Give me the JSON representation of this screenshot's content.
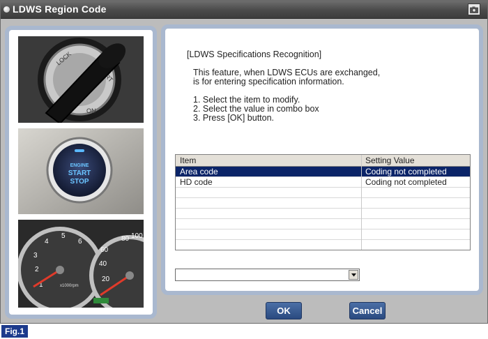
{
  "window": {
    "title": "LDWS Region Code",
    "icons": {
      "title_bullet": "window-bullet-icon",
      "title_button": "camera-icon"
    }
  },
  "images": {
    "ignition_key": "ignition-key-photo",
    "start_stop_button": "engine-start-stop-button-photo",
    "gauge_cluster": "instrument-cluster-photo"
  },
  "instructions": {
    "heading": "[LDWS Specifications Recognition]",
    "description": [
      "This feature, when LDWS ECUs are exchanged,",
      "is for entering specification information."
    ],
    "steps": [
      "1. Select the item to modify.",
      "2. Select the value in combo box",
      "3. Press [OK] button."
    ]
  },
  "table": {
    "columns": [
      "Item",
      "Setting Value"
    ],
    "rows": [
      {
        "item": "Area code",
        "value": "Coding not completed",
        "selected": true
      },
      {
        "item": "HD code",
        "value": "Coding not completed",
        "selected": false
      }
    ]
  },
  "combo": {
    "value": ""
  },
  "buttons": {
    "ok": "OK",
    "cancel": "Cancel"
  },
  "figure_label": "Fig.1"
}
